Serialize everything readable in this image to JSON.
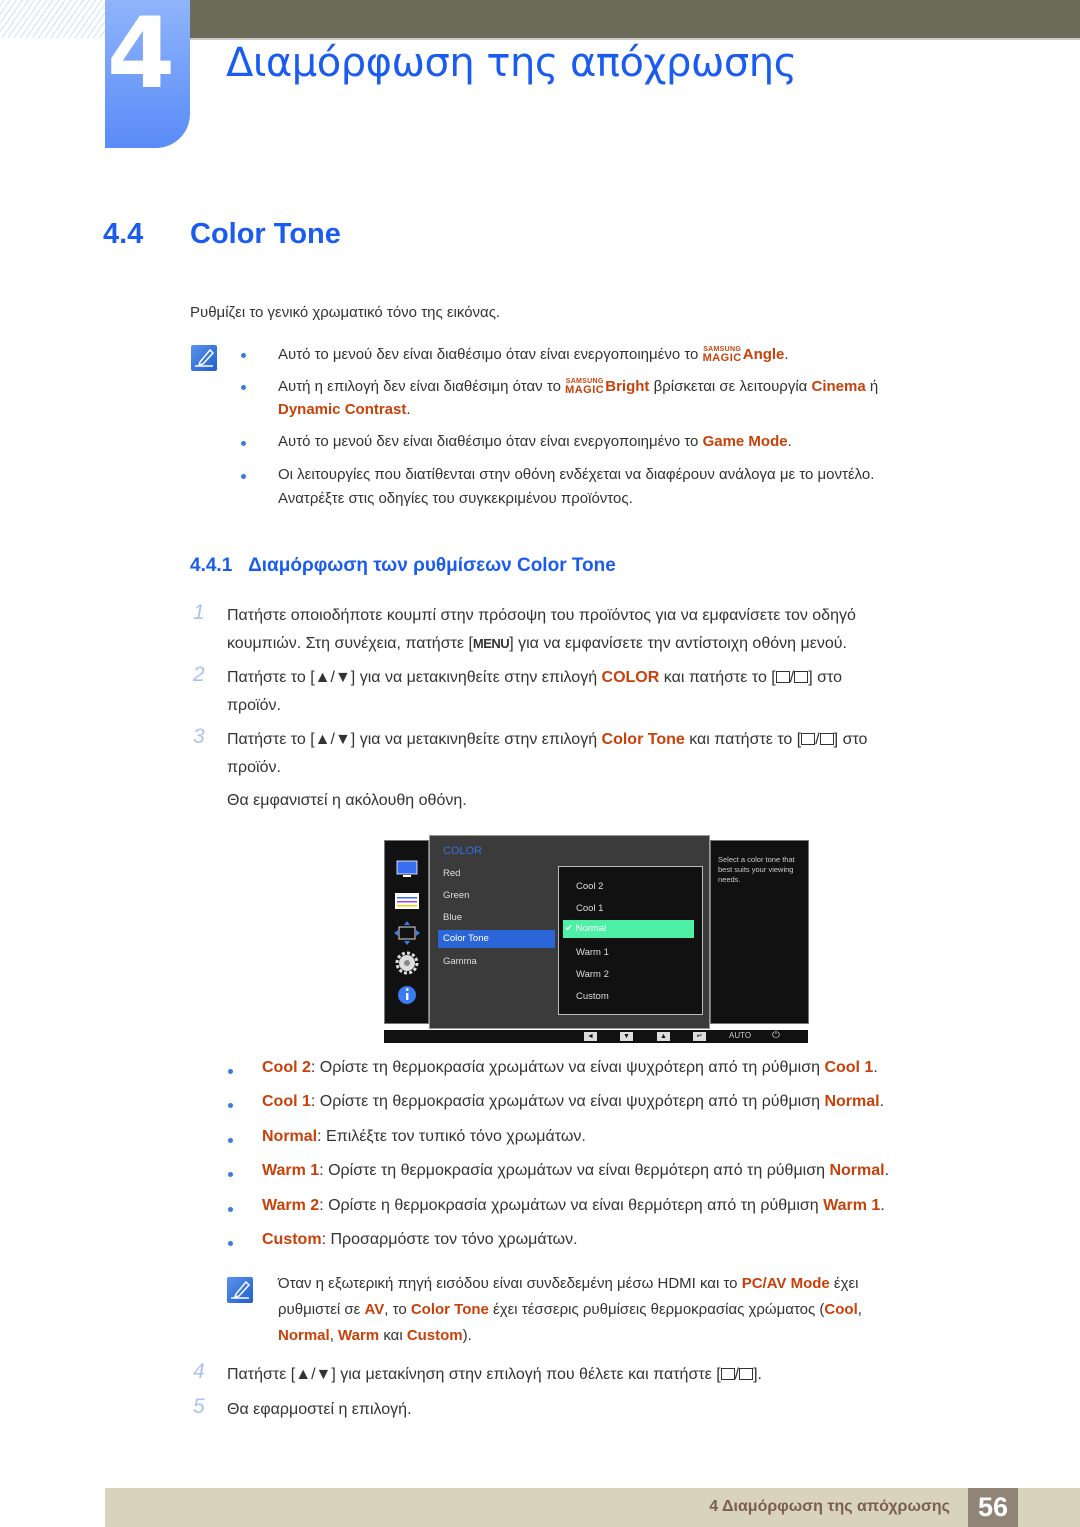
{
  "header": {
    "chapter_number": "4",
    "chapter_title": "Διαμόρφωση της απόχρωσης"
  },
  "section": {
    "number": "4.4",
    "title": "Color Tone",
    "intro": "Ρυθμίζει το γενικό χρωματικό τόνο της εικόνας."
  },
  "notes": {
    "icon": "note-pencil-icon",
    "n1_text": "Αυτό το μενού δεν είναι διαθέσιμο όταν είναι ενεργοποιημένο το ",
    "n1_magic_top": "SAMSUNG",
    "n1_magic_bottom": "MAGIC",
    "n1_hl": "Angle",
    "n1_end": ".",
    "n2_text": "Αυτή η επιλογή δεν είναι διαθέσιμη όταν το ",
    "n2_magic_top": "SAMSUNG",
    "n2_magic_bottom": "MAGIC",
    "n2_hl1": "Bright",
    "n2_mid": " βρίσκεται σε λειτουργία ",
    "n2_hl2": "Cinema",
    "n2_or": " ή",
    "n2_hl3": "Dynamic Contrast",
    "n2_end": ".",
    "n3_text": "Αυτό το μενού δεν είναι διαθέσιμο όταν είναι ενεργοποιημένο το ",
    "n3_hl": "Game Mode",
    "n3_end": ".",
    "n4_line1": "Οι λειτουργίες που διατίθενται στην οθόνη ενδέχεται να διαφέρουν ανάλογα με το μοντέλο.",
    "n4_line2": "Ανατρέξτε στις οδηγίες του συγκεκριμένου προϊόντος."
  },
  "subsection": {
    "number": "4.4.1",
    "title": "Διαμόρφωση των ρυθμίσεων Color Tone"
  },
  "steps": {
    "s1_num": "1",
    "s1_line1": "Πατήστε οποιοδήποτε κουμπί στην πρόσοψη του προϊόντος για να εμφανίσετε τον οδηγό",
    "s1_line2a": "κουμπιών. Στη συνέχεια, πατήστε [",
    "s1_key": "MENU",
    "s1_line2b": "] για να εμφανίσετε την αντίστοιχη οθόνη μενού.",
    "s2_num": "2",
    "s2_a": "Πατήστε το [▲/▼] για να μετακινηθείτε στην επιλογή ",
    "s2_hl": "COLOR",
    "s2_b": " και πατήστε το [",
    "s2_c": "] στο",
    "s2_line2": "προϊόν.",
    "s3_num": "3",
    "s3_a": "Πατήστε το [▲/▼] για να μετακινηθείτε στην επιλογή ",
    "s3_hl": "Color Tone",
    "s3_b": " και πατήστε το [",
    "s3_c": "] στο",
    "s3_line2": "προϊόν.",
    "s3_after": "Θα εμφανιστεί η ακόλουθη οθόνη.",
    "s4_num": "4",
    "s4_a": "Πατήστε [▲/▼] για μετακίνηση στην επιλογή που θέλετε και πατήστε [",
    "s4_b": "].",
    "s5_num": "5",
    "s5_text": "Θα εφαρμοστεί η επιλογή."
  },
  "osd": {
    "side_icons": [
      "monitor-icon",
      "color-bars-icon",
      "size-position-icon",
      "settings-gear-icon",
      "info-icon"
    ],
    "menu_title": "COLOR",
    "menu_items": [
      "Red",
      "Green",
      "Blue",
      "Color Tone",
      "Gamma"
    ],
    "selected_menu_item": "Color Tone",
    "options": [
      "Cool 2",
      "Cool 1",
      "Normal",
      "Warm 1",
      "Warm 2",
      "Custom"
    ],
    "selected_option": "Normal",
    "check_mark": "✔",
    "help_text": "Select a color tone that best suits your viewing needs.",
    "bottom_keys": [
      "◄",
      "▼",
      "▲",
      "↵"
    ],
    "auto_label": "AUTO",
    "power_symbol": "⏻"
  },
  "options_desc": [
    {
      "name": "Cool 2",
      "text": ": Ορίστε τη θερμοκρασία χρωμάτων να είναι ψυχρότερη από τη ρύθμιση ",
      "ref": "Cool 1",
      "end": "."
    },
    {
      "name": "Cool 1",
      "text": ": Ορίστε τη θερμοκρασία χρωμάτων να είναι ψυχρότερη από τη ρύθμιση ",
      "ref": "Normal",
      "end": "."
    },
    {
      "name": "Normal",
      "text": ": Επιλέξτε τον τυπικό τόνο χρωμάτων.",
      "ref": "",
      "end": ""
    },
    {
      "name": "Warm 1",
      "text": ": Ορίστε τη θερμοκρασία χρωμάτων να είναι θερμότερη από τη ρύθμιση ",
      "ref": "Normal",
      "end": "."
    },
    {
      "name": "Warm 2",
      "text": ": Ορίστε η θερμοκρασία χρωμάτων να είναι θερμότερη από τη ρύθμιση ",
      "ref": "Warm 1",
      "end": "."
    },
    {
      "name": "Custom",
      "text": ": Προσαρμόστε τον τόνο χρωμάτων.",
      "ref": "",
      "end": ""
    }
  ],
  "hdmi_note": {
    "a": "Όταν η εξωτερική πηγή εισόδου είναι συνδεδεμένη μέσω HDMI και το ",
    "hl1": "PC/AV Mode",
    "b": " έχει",
    "c": "ρυθμιστεί σε ",
    "hl2": "AV",
    "d": ", το ",
    "hl3": "Color Tone",
    "e": " έχει τέσσερις ρυθμίσεις θερμοκρασίας χρώματος (",
    "hl4": "Cool",
    "f": ",",
    "hl5": "Normal",
    "g": ", ",
    "hl6": "Warm",
    "h": " και ",
    "hl7": "Custom",
    "i": ")."
  },
  "footer": {
    "chapter_label": "4 Διαμόρφωση της απόχρωσης",
    "page_number": "56"
  },
  "colors": {
    "heading_blue": "#1b5cf0",
    "highlight_orange": "#c8410a",
    "osd_selected_green": "#4ef0a5",
    "osd_selected_blue": "#2b66d8",
    "footer_bg": "#d9d3be",
    "page_num_bg": "#8f8476"
  }
}
